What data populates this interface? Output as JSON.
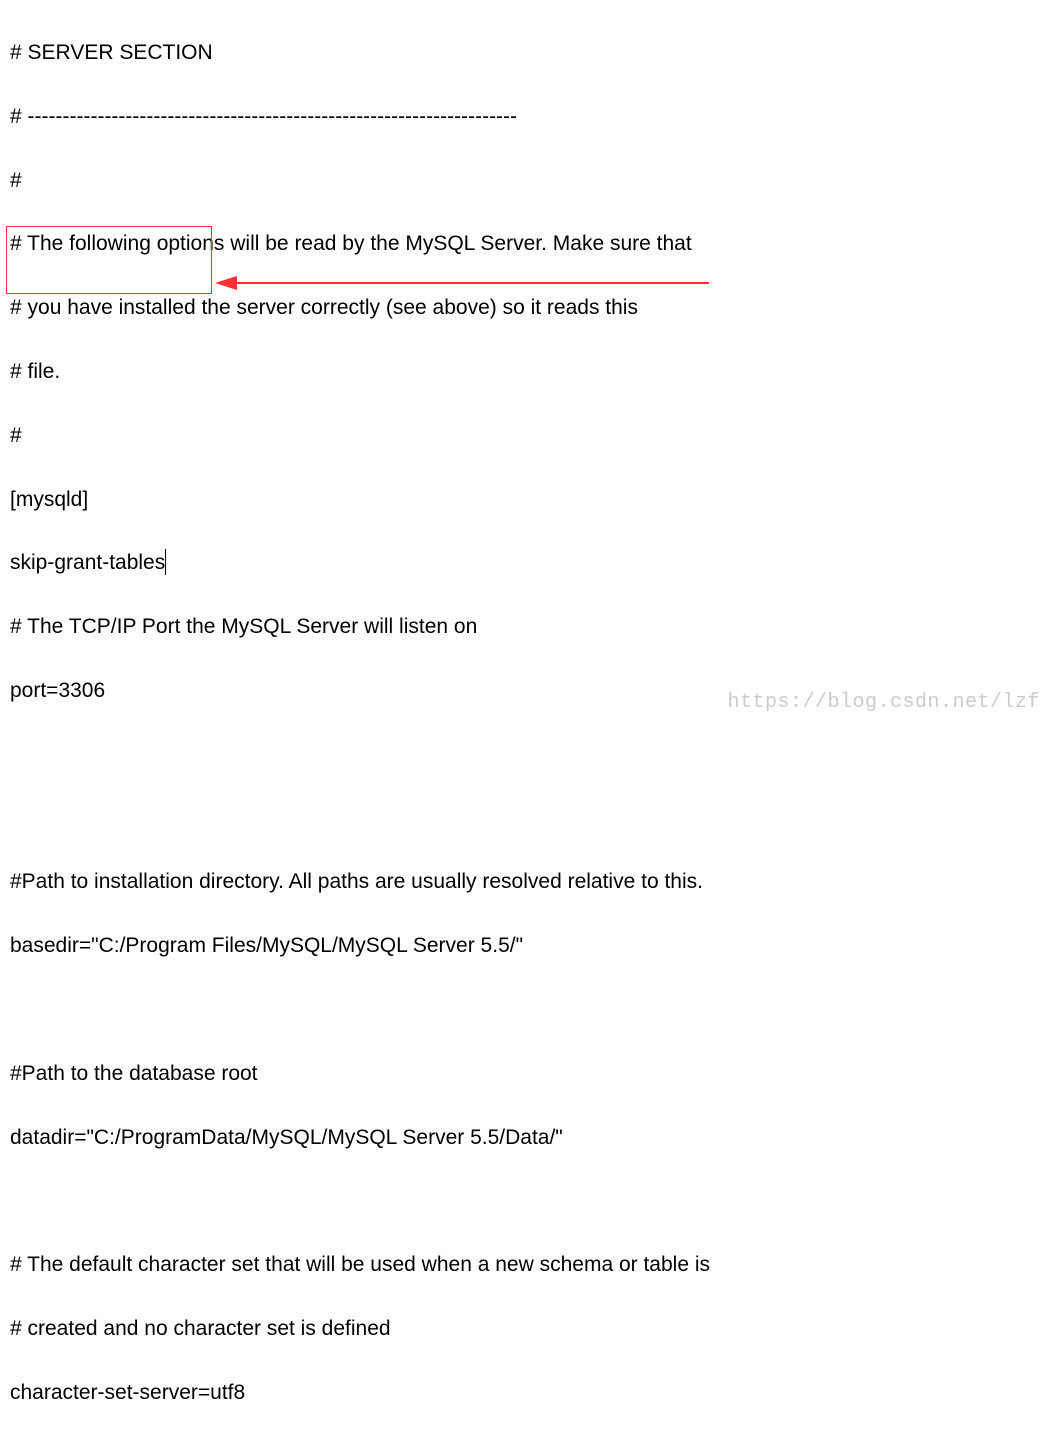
{
  "config": {
    "line1": "# SERVER SECTION",
    "line2": "# ----------------------------------------------------------------------",
    "line3": "#",
    "line4": "# The following options will be read by the MySQL Server. Make sure that",
    "line5": "# you have installed the server correctly (see above) so it reads this",
    "line6": "# file.",
    "line7": "#",
    "line8": "[mysqld]",
    "line9": "skip-grant-tables",
    "line10": "# The TCP/IP Port the MySQL Server will listen on",
    "line11": "port=3306",
    "line12": "",
    "line13": "",
    "line14": "#Path to installation directory. All paths are usually resolved relative to this.",
    "line15": "basedir=\"C:/Program Files/MySQL/MySQL Server 5.5/\"",
    "line16": "",
    "line17": "#Path to the database root",
    "line18": "datadir=\"C:/ProgramData/MySQL/MySQL Server 5.5/Data/\"",
    "line19": "",
    "line20": "# The default character set that will be used when a new schema or table is",
    "line21": "# created and no character set is defined",
    "line22": "character-set-server=utf8"
  },
  "watermark": "https://blog.csdn.net/lzf"
}
